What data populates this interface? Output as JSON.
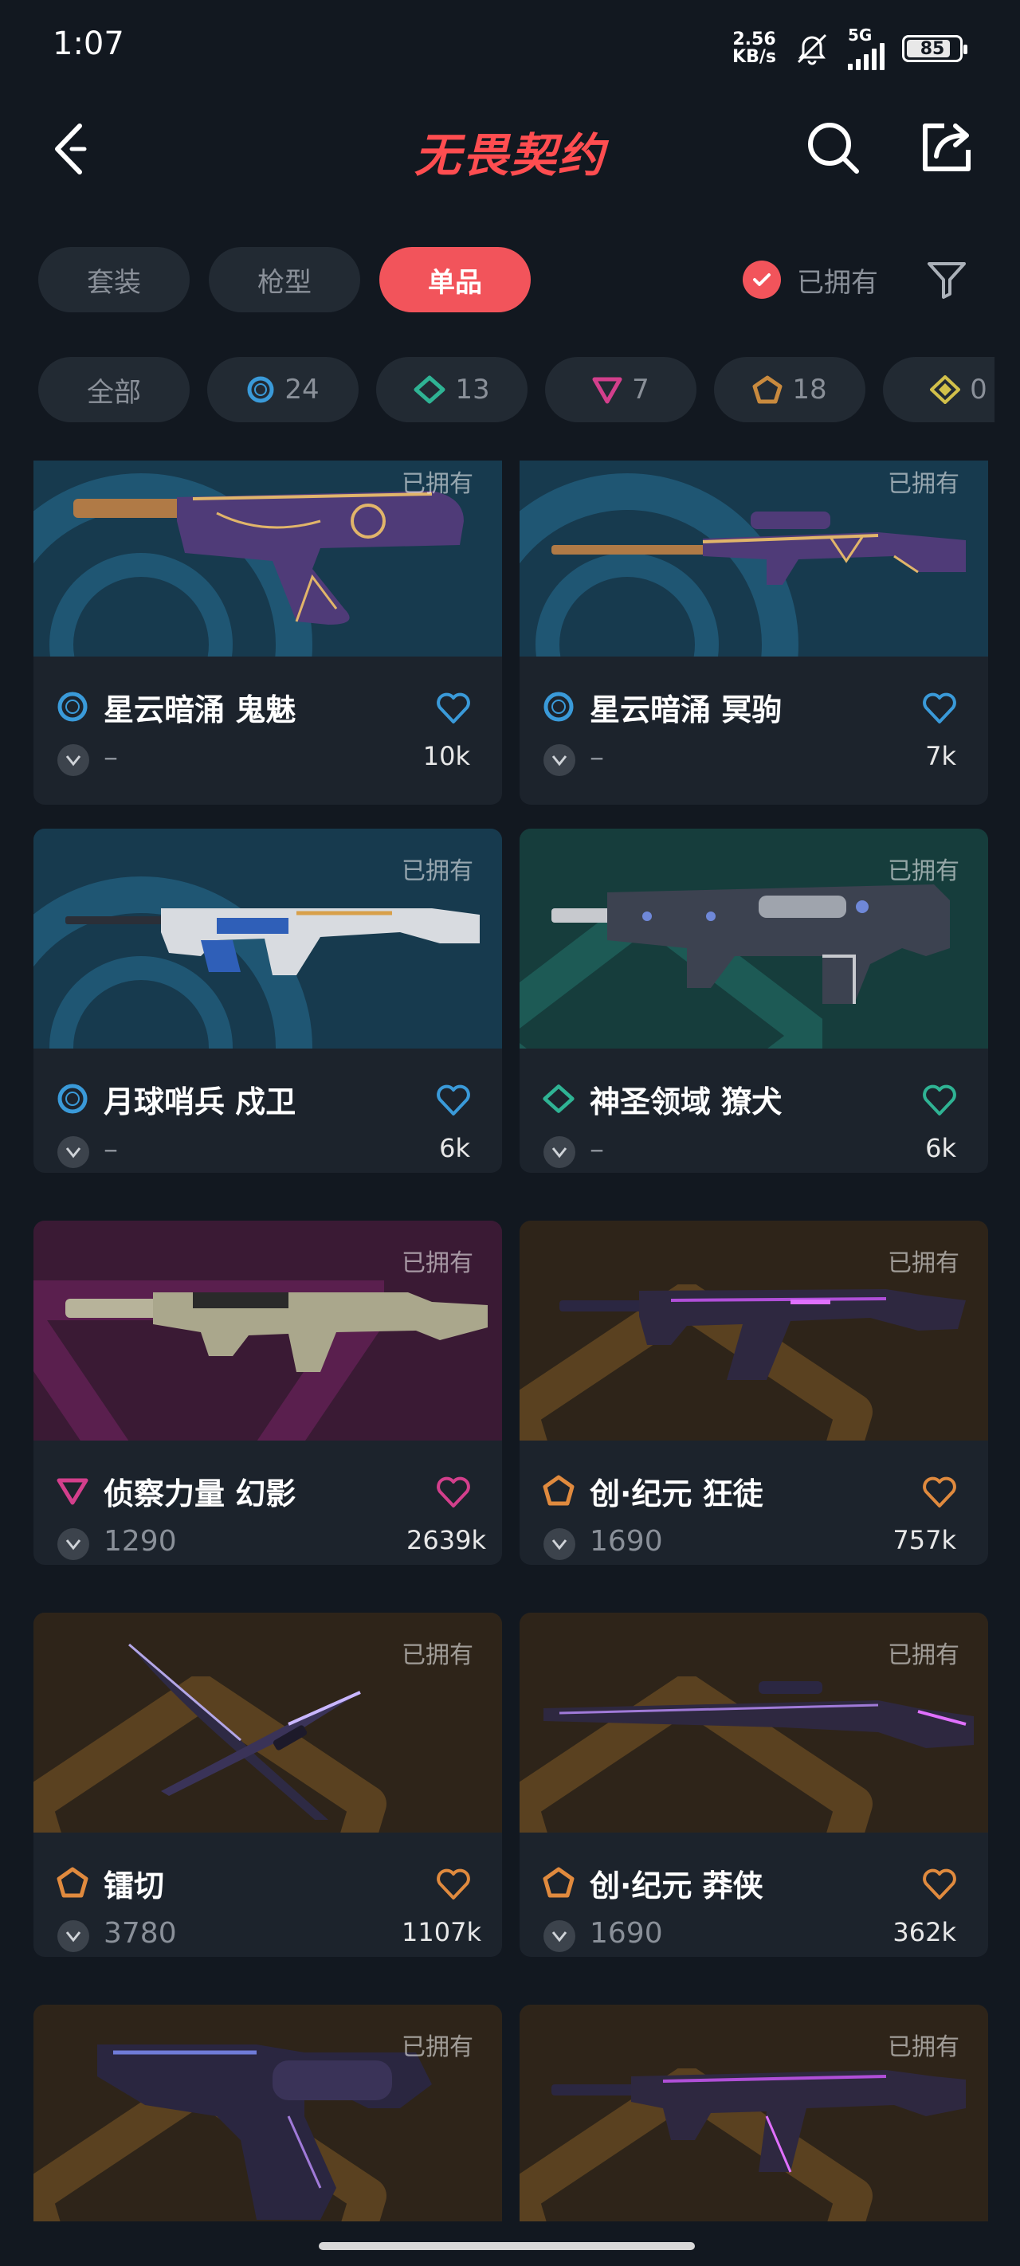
{
  "status": {
    "time": "1:07",
    "net_speed_top": "2.56",
    "net_speed_bottom": "KB/s",
    "signal_label": "5G",
    "battery": "85",
    "battery_level": 0.85
  },
  "header": {
    "title": "无畏契约"
  },
  "tabs": [
    {
      "label": "套装",
      "active": false
    },
    {
      "label": "枪型",
      "active": false
    },
    {
      "label": "单品",
      "active": true
    }
  ],
  "owned_filter": {
    "label": "已拥有",
    "checked": true
  },
  "chips": [
    {
      "label": "全部",
      "icon": "all"
    },
    {
      "label": "24",
      "icon": "select-tier-icon",
      "color": "#3a9ad9"
    },
    {
      "label": "13",
      "icon": "deluxe-tier-icon",
      "color": "#2fb394"
    },
    {
      "label": "7",
      "icon": "premium-tier-icon",
      "color": "#d33f8c"
    },
    {
      "label": "18",
      "icon": "exclusive-tier-icon",
      "color": "#c98a3e"
    },
    {
      "label": "0",
      "icon": "ultra-tier-icon",
      "color": "#d2c04a"
    }
  ],
  "cards": [
    {
      "owned": "已拥有",
      "name": "星云暗涌 鬼魅",
      "price": "–",
      "likes": "10k",
      "tier_color": "#3a9ad9",
      "tier": "select"
    },
    {
      "owned": "已拥有",
      "name": "星云暗涌 冥驹",
      "price": "–",
      "likes": "7k",
      "tier_color": "#3a9ad9",
      "tier": "select"
    },
    {
      "owned": "已拥有",
      "name": "月球哨兵 戍卫",
      "price": "–",
      "likes": "6k",
      "tier_color": "#3a9ad9",
      "tier": "select"
    },
    {
      "owned": "已拥有",
      "name": "神圣领域 獠犬",
      "price": "–",
      "likes": "6k",
      "tier_color": "#2fb394",
      "tier": "deluxe"
    },
    {
      "owned": "已拥有",
      "name": "侦察力量 幻影",
      "price": "1290",
      "likes": "2639k",
      "tier_color": "#d33f8c",
      "tier": "premium"
    },
    {
      "owned": "已拥有",
      "name": "创·纪元 狂徒",
      "price": "1690",
      "likes": "757k",
      "tier_color": "#e08a3e",
      "tier": "exclusive"
    },
    {
      "owned": "已拥有",
      "name": "镭切",
      "price": "3780",
      "likes": "1107k",
      "tier_color": "#e08a3e",
      "tier": "exclusive"
    },
    {
      "owned": "已拥有",
      "name": "创·纪元 莽侠",
      "price": "1690",
      "likes": "362k",
      "tier_color": "#e08a3e",
      "tier": "exclusive"
    },
    {
      "owned": "已拥有",
      "name": "",
      "price": "",
      "likes": "",
      "tier_color": "#e08a3e",
      "tier": "exclusive"
    },
    {
      "owned": "已拥有",
      "name": "",
      "price": "",
      "likes": "",
      "tier_color": "#e08a3e",
      "tier": "exclusive"
    }
  ]
}
